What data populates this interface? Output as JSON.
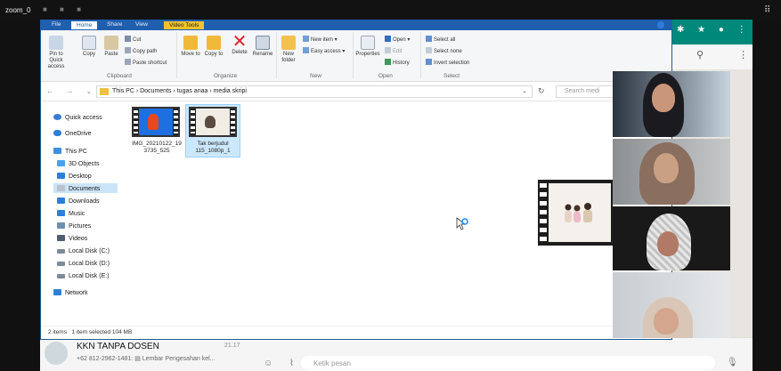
{
  "zoom": {
    "title": "zoom_0"
  },
  "explorer": {
    "tabs": {
      "file": "File",
      "home": "Home",
      "share": "Share",
      "view": "View",
      "video_tools": "Video Tools"
    },
    "ribbon": {
      "pin": "Pin to Quick access",
      "copy": "Copy",
      "paste": "Paste",
      "cut": "Cut",
      "copy_path": "Copy path",
      "paste_shortcut": "Paste shortcut",
      "clipboard": "Clipboard",
      "move_to": "Move to",
      "copy_to": "Copy to",
      "delete": "Delete",
      "rename": "Rename",
      "organize": "Organize",
      "new_folder": "New folder",
      "new_item": "New item",
      "easy_access": "Easy access",
      "new": "New",
      "properties": "Properties",
      "open": "Open",
      "edit": "Edit",
      "history": "History",
      "open_group": "Open",
      "select_all": "Select all",
      "select_none": "Select none",
      "invert_selection": "Invert selection",
      "select": "Select"
    },
    "address": "This PC  ›  Documents  ›  tugas anaa  ›  media skripi",
    "search_placeholder": "Search medi",
    "nav": {
      "quick_access": "Quick access",
      "onedrive": "OneDrive",
      "this_pc": "This PC",
      "objects3d": "3D Objects",
      "desktop": "Desktop",
      "documents": "Documents",
      "downloads": "Downloads",
      "music": "Music",
      "pictures": "Pictures",
      "videos": "Videos",
      "local_c": "Local Disk (C:)",
      "local_d": "Local Disk (D:)",
      "local_e": "Local Disk (E:)",
      "network": "Network"
    },
    "files": [
      {
        "name_line1": "IMG_20210122_19",
        "name_line2": "3735_525"
      },
      {
        "name_line1": "Tak berjudul",
        "name_line2": "115_1080p_1"
      }
    ],
    "status": {
      "count": "2 items",
      "selection": "1 item selected  104 MB"
    }
  },
  "whatsapp": {
    "chat_name": "KKN TANPA DOSEN",
    "chat_time": "21.17",
    "chat_preview": "+62 812-2962-1481: ▤ Lembar Pengesahan kel...",
    "input_placeholder": "Ketik pesan"
  },
  "colors": {
    "accent": "#1f5fae",
    "video_tools": "#f0c230",
    "whatsapp": "#00897b"
  }
}
